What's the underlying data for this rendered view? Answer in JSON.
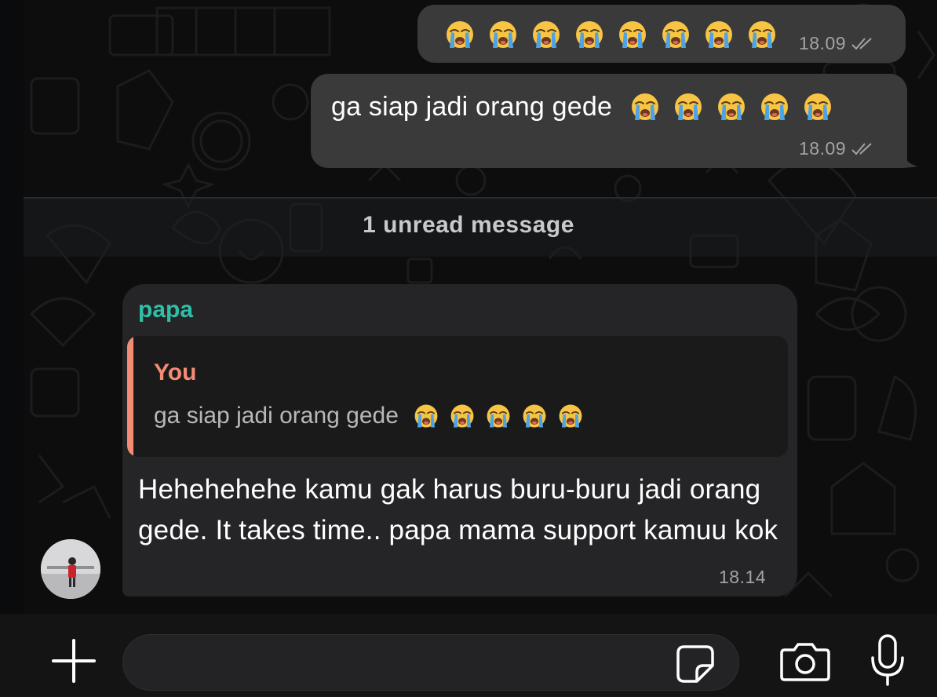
{
  "messages_out": [
    {
      "emoji_count": 8,
      "emoji": "crying-face",
      "time": "18.09",
      "status": "read"
    },
    {
      "text": "ga siap jadi orang gede",
      "emoji_count": 5,
      "emoji": "crying-face",
      "time": "18.09",
      "status": "read"
    }
  ],
  "unread_divider": "1 unread message",
  "message_in": {
    "sender": "papa",
    "quote": {
      "author": "You",
      "text": "ga siap jadi orang gede",
      "emoji_count": 5
    },
    "text": "Hehehehehe kamu gak harus buru-buru jadi orang gede. It takes time.. papa mama support kamuu kok",
    "time": "18.14"
  },
  "composer": {
    "icons": [
      "plus-icon",
      "sticker-icon",
      "camera-icon",
      "microphone-icon"
    ]
  },
  "colors": {
    "outgoing_bubble": "#3a3a3b",
    "incoming_bubble": "#252527",
    "sender_name": "#2fbfa7",
    "quote_accent": "#f28c74"
  }
}
